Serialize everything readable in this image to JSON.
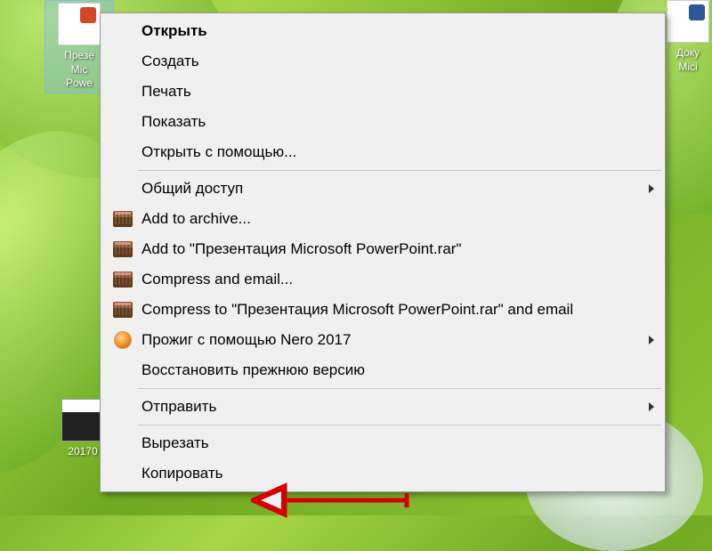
{
  "desktop": {
    "icon1_label": "Презе\nMic\nPowe",
    "icon2_label": "Доку\nMici",
    "icon3_label": "20170"
  },
  "menu": {
    "open": "Открыть",
    "create": "Создать",
    "print": "Печать",
    "show": "Показать",
    "open_with": "Открыть с помощью...",
    "sharing": "Общий доступ",
    "rar_add": "Add to archive...",
    "rar_add_named": "Add to \"Презентация Microsoft PowerPoint.rar\"",
    "rar_compress_email": "Compress and email...",
    "rar_compress_named_email": "Compress to \"Презентация Microsoft PowerPoint.rar\" and email",
    "nero": "Прожиг с помощью Nero 2017",
    "restore": "Восстановить прежнюю версию",
    "send": "Отправить",
    "cut": "Вырезать",
    "copy": "Копировать"
  }
}
